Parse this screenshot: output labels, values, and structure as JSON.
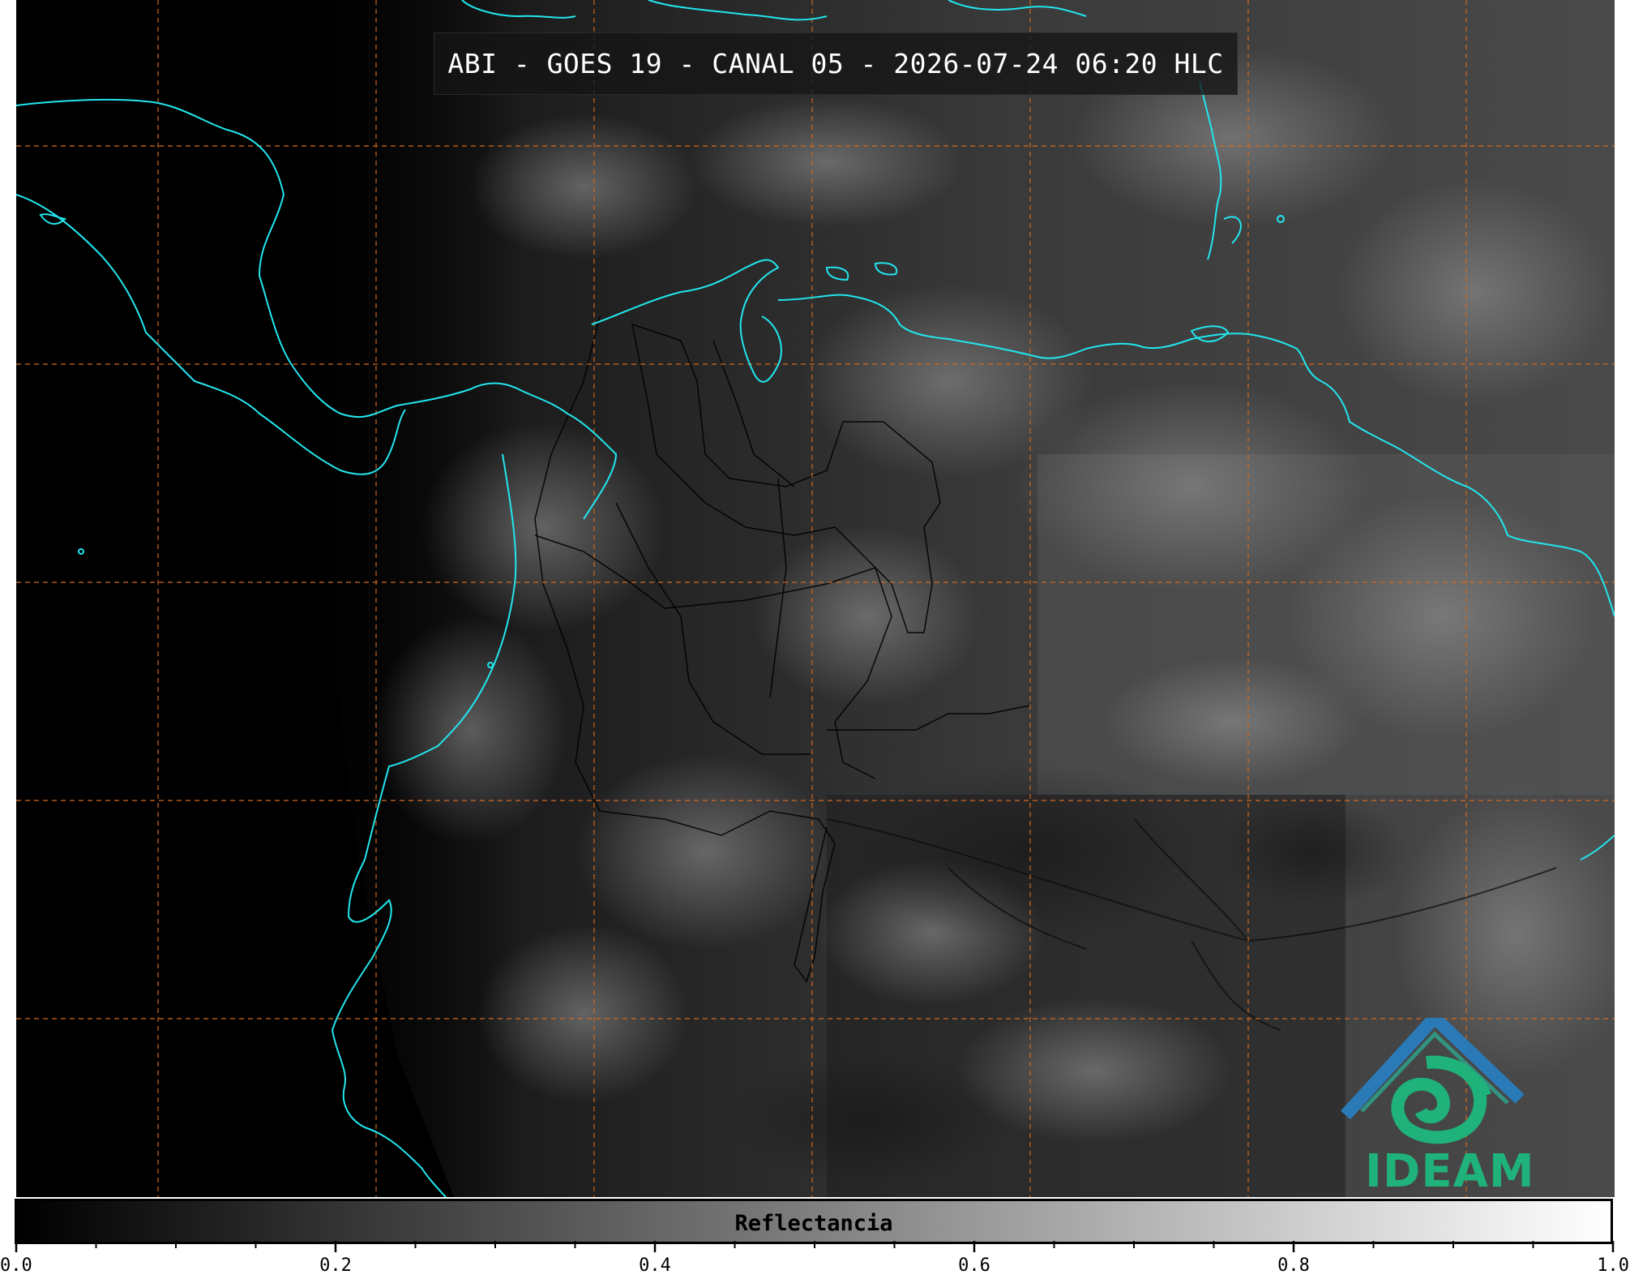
{
  "title": "ABI - GOES 19 - CANAL 05 - 2026-07-24 06:20 HLC",
  "logo": {
    "text": "IDEAM",
    "colors": {
      "roof": "#2a7ab8",
      "swirl": "#1fb27a"
    }
  },
  "colorbar": {
    "label": "Reflectancia",
    "range": [
      0.0,
      1.0
    ],
    "colormap": [
      "#000000",
      "#ffffff"
    ],
    "major_ticks": [
      "0.0",
      "0.2",
      "0.4",
      "0.6",
      "0.8",
      "1.0"
    ],
    "minor_step": 0.05
  },
  "map": {
    "colors": {
      "background": "#000000",
      "coastline": "#22e6ee",
      "grid": "#d2691e",
      "borders": "#000000"
    },
    "gridlines": {
      "style": "dashed",
      "vertical_count": 7,
      "horizontal_count": 5
    }
  }
}
